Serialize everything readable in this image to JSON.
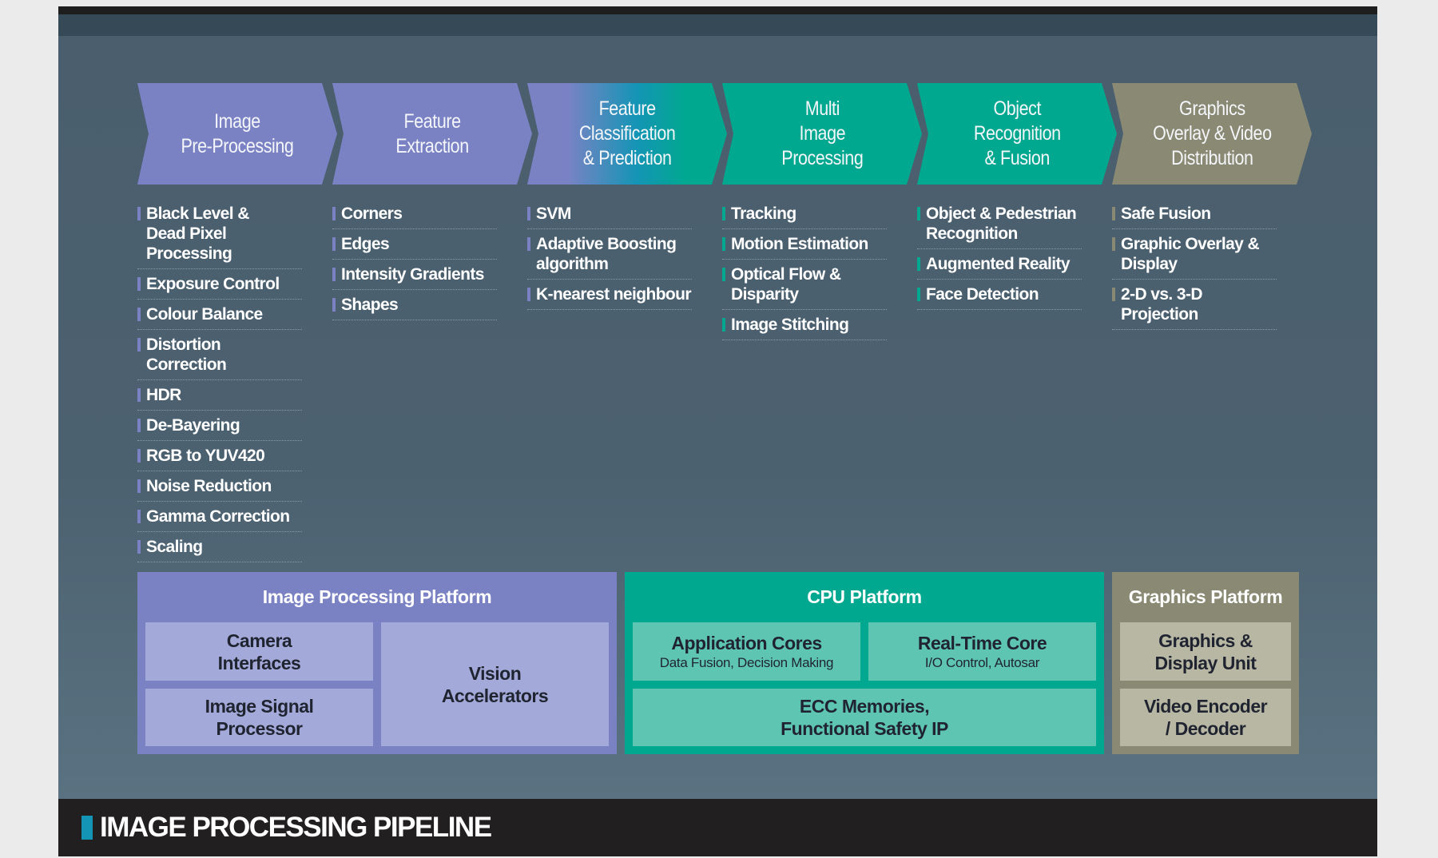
{
  "footer": {
    "title": "IMAGE PROCESSING PIPELINE"
  },
  "colors": {
    "purple": "#7a82c4",
    "teal": "#00a88f",
    "olive": "#8a8a74",
    "accent_blue": "#1495b5",
    "background": "#4b5f6e"
  },
  "stages": [
    {
      "label": "Image\nPre-Processing",
      "items": [
        "Black Level &\nDead Pixel Processing",
        "Exposure Control",
        "Colour Balance",
        "Distortion Correction",
        "HDR",
        "De-Bayering",
        "RGB to YUV420",
        "Noise Reduction",
        "Gamma Correction",
        "Scaling"
      ]
    },
    {
      "label": "Feature\nExtraction",
      "items": [
        "Corners",
        "Edges",
        "Intensity Gradients",
        "Shapes"
      ]
    },
    {
      "label": "Feature\nClassification\n& Prediction",
      "items": [
        "SVM",
        "Adaptive Boosting\nalgorithm",
        "K-nearest neighbour"
      ]
    },
    {
      "label": "Multi\nImage\nProcessing",
      "items": [
        "Tracking",
        "Motion Estimation",
        "Optical Flow & Disparity",
        "Image Stitching"
      ]
    },
    {
      "label": "Object\nRecognition\n& Fusion",
      "items": [
        "Object & Pedestrian\nRecognition",
        "Augmented Reality",
        "Face Detection"
      ]
    },
    {
      "label": "Graphics\nOverlay & Video\nDistribution",
      "items": [
        "Safe Fusion",
        "Graphic Overlay & Display",
        "2-D vs. 3-D Projection"
      ]
    }
  ],
  "platforms": {
    "image": {
      "title": "Image Processing Platform",
      "camera": "Camera\nInterfaces",
      "isp": "Image Signal\nProcessor",
      "vision": "Vision\nAccelerators"
    },
    "cpu": {
      "title": "CPU Platform",
      "app_title": "Application Cores",
      "app_sub": "Data Fusion, Decision Making",
      "rt_title": "Real-Time Core",
      "rt_sub": "I/O Control, Autosar",
      "ecc": "ECC Memories,\nFunctional Safety IP"
    },
    "graphics": {
      "title": "Graphics Platform",
      "gdu": "Graphics &\nDisplay Unit",
      "video": "Video Encoder\n/ Decoder"
    }
  }
}
